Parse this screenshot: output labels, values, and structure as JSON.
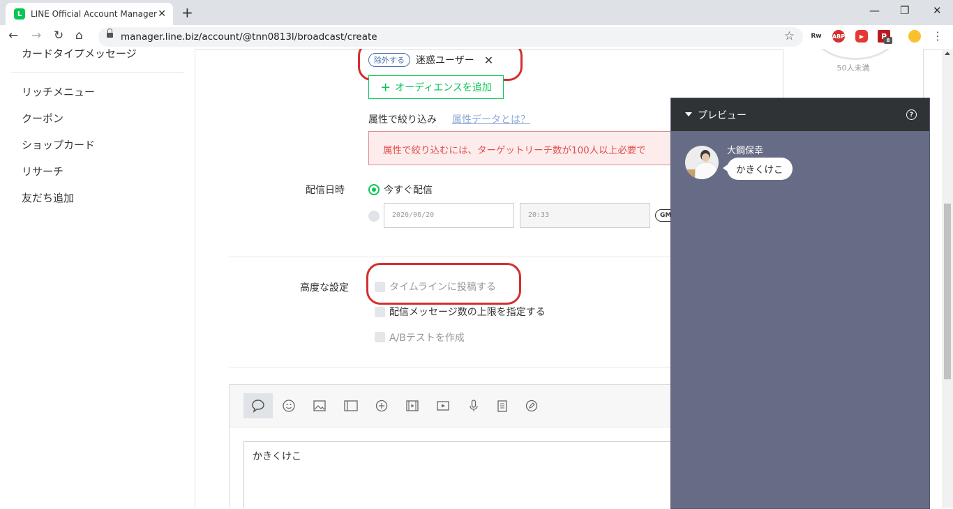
{
  "browser": {
    "tab_title": "LINE Official Account Manager",
    "tab_favicon_letter": "L",
    "url": "manager.line.biz/account/@tnn0813l/broadcast/create",
    "extensions": [
      {
        "name": "rw-icon",
        "label": "Rw",
        "color": "#ffffff"
      },
      {
        "name": "adblock-icon",
        "label": "ABP",
        "color": "#d32f2f"
      },
      {
        "name": "video-ext-icon",
        "label": "▶",
        "color": "#e53935"
      },
      {
        "name": "p-ext-icon",
        "label": "P",
        "color": "#b71c1c",
        "badge": "8"
      },
      {
        "name": "profile-icon",
        "label": "",
        "color": "#fbc02d"
      }
    ]
  },
  "sidebar": {
    "cut_item": "カードタイプメッセージ",
    "items": [
      "リッチメニュー",
      "クーポン",
      "ショップカード",
      "リサーチ",
      "友だち追加"
    ]
  },
  "audience": {
    "exclude_pill": "除外する",
    "tag_label": "迷惑ユーザー",
    "add_button": "オーディエンスを追加",
    "attr_label": "属性で絞り込み",
    "attr_link": "属性データとは？",
    "alert": "属性で絞り込むには、ターゲットリーチ数が100人以上必要で"
  },
  "schedule": {
    "label": "配信日時",
    "now_label": "今すぐ配信",
    "date_placeholder": "2020/06/20",
    "time_placeholder": "20:33",
    "tz_label": "GM"
  },
  "advanced": {
    "label": "高度な設定",
    "options": [
      "タイムラインに投稿する",
      "配信メッセージ数の上限を指定する",
      "A/Bテストを作成"
    ]
  },
  "editor": {
    "text": "かきくけこ"
  },
  "stats": {
    "reach_text": "50人未満"
  },
  "preview": {
    "title": "プレビュー",
    "help_symbol": "?",
    "sender": "大鋼保幸",
    "message": "かきくけこ"
  },
  "colors": {
    "line_green": "#06c755",
    "annotation_red": "#d32f2f",
    "preview_bg": "#666c85"
  }
}
